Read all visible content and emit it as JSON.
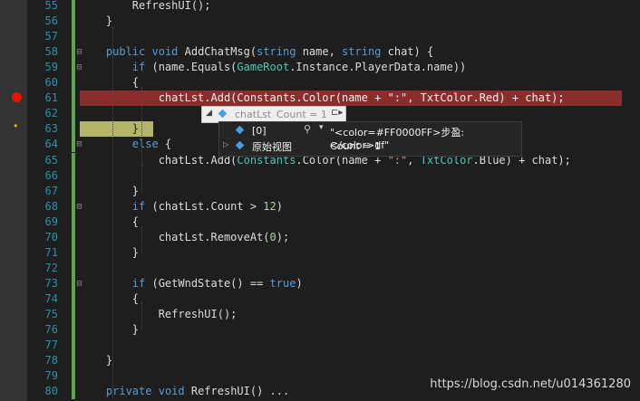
{
  "editor": {
    "lines": [
      {
        "n": "55",
        "code": [
          {
            "t": "        RefreshUI();",
            "c": ""
          }
        ]
      },
      {
        "n": "56",
        "code": [
          {
            "t": "    }",
            "c": ""
          }
        ]
      },
      {
        "n": "57",
        "code": []
      },
      {
        "n": "58",
        "code": [
          {
            "t": "    ",
            "c": ""
          },
          {
            "t": "public",
            "c": "kw"
          },
          {
            "t": " ",
            "c": ""
          },
          {
            "t": "void",
            "c": "kw"
          },
          {
            "t": " AddChatMsg(",
            "c": ""
          },
          {
            "t": "string",
            "c": "kw"
          },
          {
            "t": " name, ",
            "c": ""
          },
          {
            "t": "string",
            "c": "kw"
          },
          {
            "t": " chat) {",
            "c": ""
          }
        ]
      },
      {
        "n": "59",
        "code": [
          {
            "t": "        ",
            "c": ""
          },
          {
            "t": "if",
            "c": "kw"
          },
          {
            "t": " (name.Equals(",
            "c": ""
          },
          {
            "t": "GameRoot",
            "c": "ty"
          },
          {
            "t": ".Instance.PlayerData.name))",
            "c": ""
          }
        ]
      },
      {
        "n": "60",
        "code": [
          {
            "t": "        {",
            "c": ""
          }
        ]
      },
      {
        "n": "61",
        "code": [
          {
            "t": "            chatLst.Add(Constants.Color(name + \":\", TxtColor.Red) + chat);",
            "c": ""
          }
        ]
      },
      {
        "n": "62",
        "code": []
      },
      {
        "n": "63",
        "code": [
          {
            "t": "        }",
            "c": "cur"
          }
        ]
      },
      {
        "n": "64",
        "code": [
          {
            "t": "        ",
            "c": ""
          },
          {
            "t": "else",
            "c": "kw"
          },
          {
            "t": " {",
            "c": ""
          }
        ]
      },
      {
        "n": "65",
        "code": [
          {
            "t": "            chatLst.Add(",
            "c": ""
          },
          {
            "t": "Constants",
            "c": "ty"
          },
          {
            "t": ".Color(name + ",
            "c": ""
          },
          {
            "t": "\":\"",
            "c": "st"
          },
          {
            "t": ", ",
            "c": ""
          },
          {
            "t": "TxtColor",
            "c": "ty"
          },
          {
            "t": ".Blue) + chat);",
            "c": ""
          }
        ]
      },
      {
        "n": "66",
        "code": []
      },
      {
        "n": "67",
        "code": [
          {
            "t": "        }",
            "c": ""
          }
        ]
      },
      {
        "n": "68",
        "code": [
          {
            "t": "        ",
            "c": ""
          },
          {
            "t": "if",
            "c": "kw"
          },
          {
            "t": " (chatLst.Count > ",
            "c": ""
          },
          {
            "t": "12",
            "c": "nu"
          },
          {
            "t": ")",
            "c": ""
          }
        ]
      },
      {
        "n": "69",
        "code": [
          {
            "t": "        {",
            "c": ""
          }
        ]
      },
      {
        "n": "70",
        "code": [
          {
            "t": "            chatLst.RemoveAt(",
            "c": ""
          },
          {
            "t": "0",
            "c": "nu"
          },
          {
            "t": ");",
            "c": ""
          }
        ]
      },
      {
        "n": "71",
        "code": [
          {
            "t": "        }",
            "c": ""
          }
        ]
      },
      {
        "n": "72",
        "code": []
      },
      {
        "n": "73",
        "code": [
          {
            "t": "        ",
            "c": ""
          },
          {
            "t": "if",
            "c": "kw"
          },
          {
            "t": " (GetWndState() == ",
            "c": ""
          },
          {
            "t": "true",
            "c": "kw"
          },
          {
            "t": ")",
            "c": ""
          }
        ]
      },
      {
        "n": "74",
        "code": [
          {
            "t": "        {",
            "c": ""
          }
        ]
      },
      {
        "n": "75",
        "code": [
          {
            "t": "            RefreshUI();",
            "c": ""
          }
        ]
      },
      {
        "n": "76",
        "code": [
          {
            "t": "        }",
            "c": ""
          }
        ]
      },
      {
        "n": "77",
        "code": []
      },
      {
        "n": "78",
        "code": [
          {
            "t": "    }",
            "c": ""
          }
        ]
      },
      {
        "n": "79",
        "code": []
      },
      {
        "n": "80",
        "code": [
          {
            "t": "    ",
            "c": ""
          },
          {
            "t": "private",
            "c": "kw"
          },
          {
            "t": " ",
            "c": ""
          },
          {
            "t": "void",
            "c": "kw"
          },
          {
            "t": " RefreshUI() ",
            "c": ""
          },
          {
            "t": "...",
            "c": ""
          }
        ]
      }
    ]
  },
  "datatip": {
    "header": {
      "name": "chatLst",
      "count": "Count = 1",
      "pin": "⊏▸"
    },
    "rows": [
      {
        "name": "[0]",
        "value": "\"<color=#FF0000FF>步盈:</color>df\""
      },
      {
        "name": "原始视图",
        "value": "Count = 1"
      }
    ]
  },
  "watermark": "https://blog.csdn.net/u014361280",
  "colors": {
    "background": "#1e1e1e",
    "breakpoint": "#e51400",
    "breakpoint_line": "#8a2d2d",
    "current_line": "#b5b56a",
    "keyword": "#569cd6",
    "type": "#4ec9b0",
    "string": "#d69d85",
    "number": "#b5cea8",
    "line_number": "#2b91af"
  }
}
